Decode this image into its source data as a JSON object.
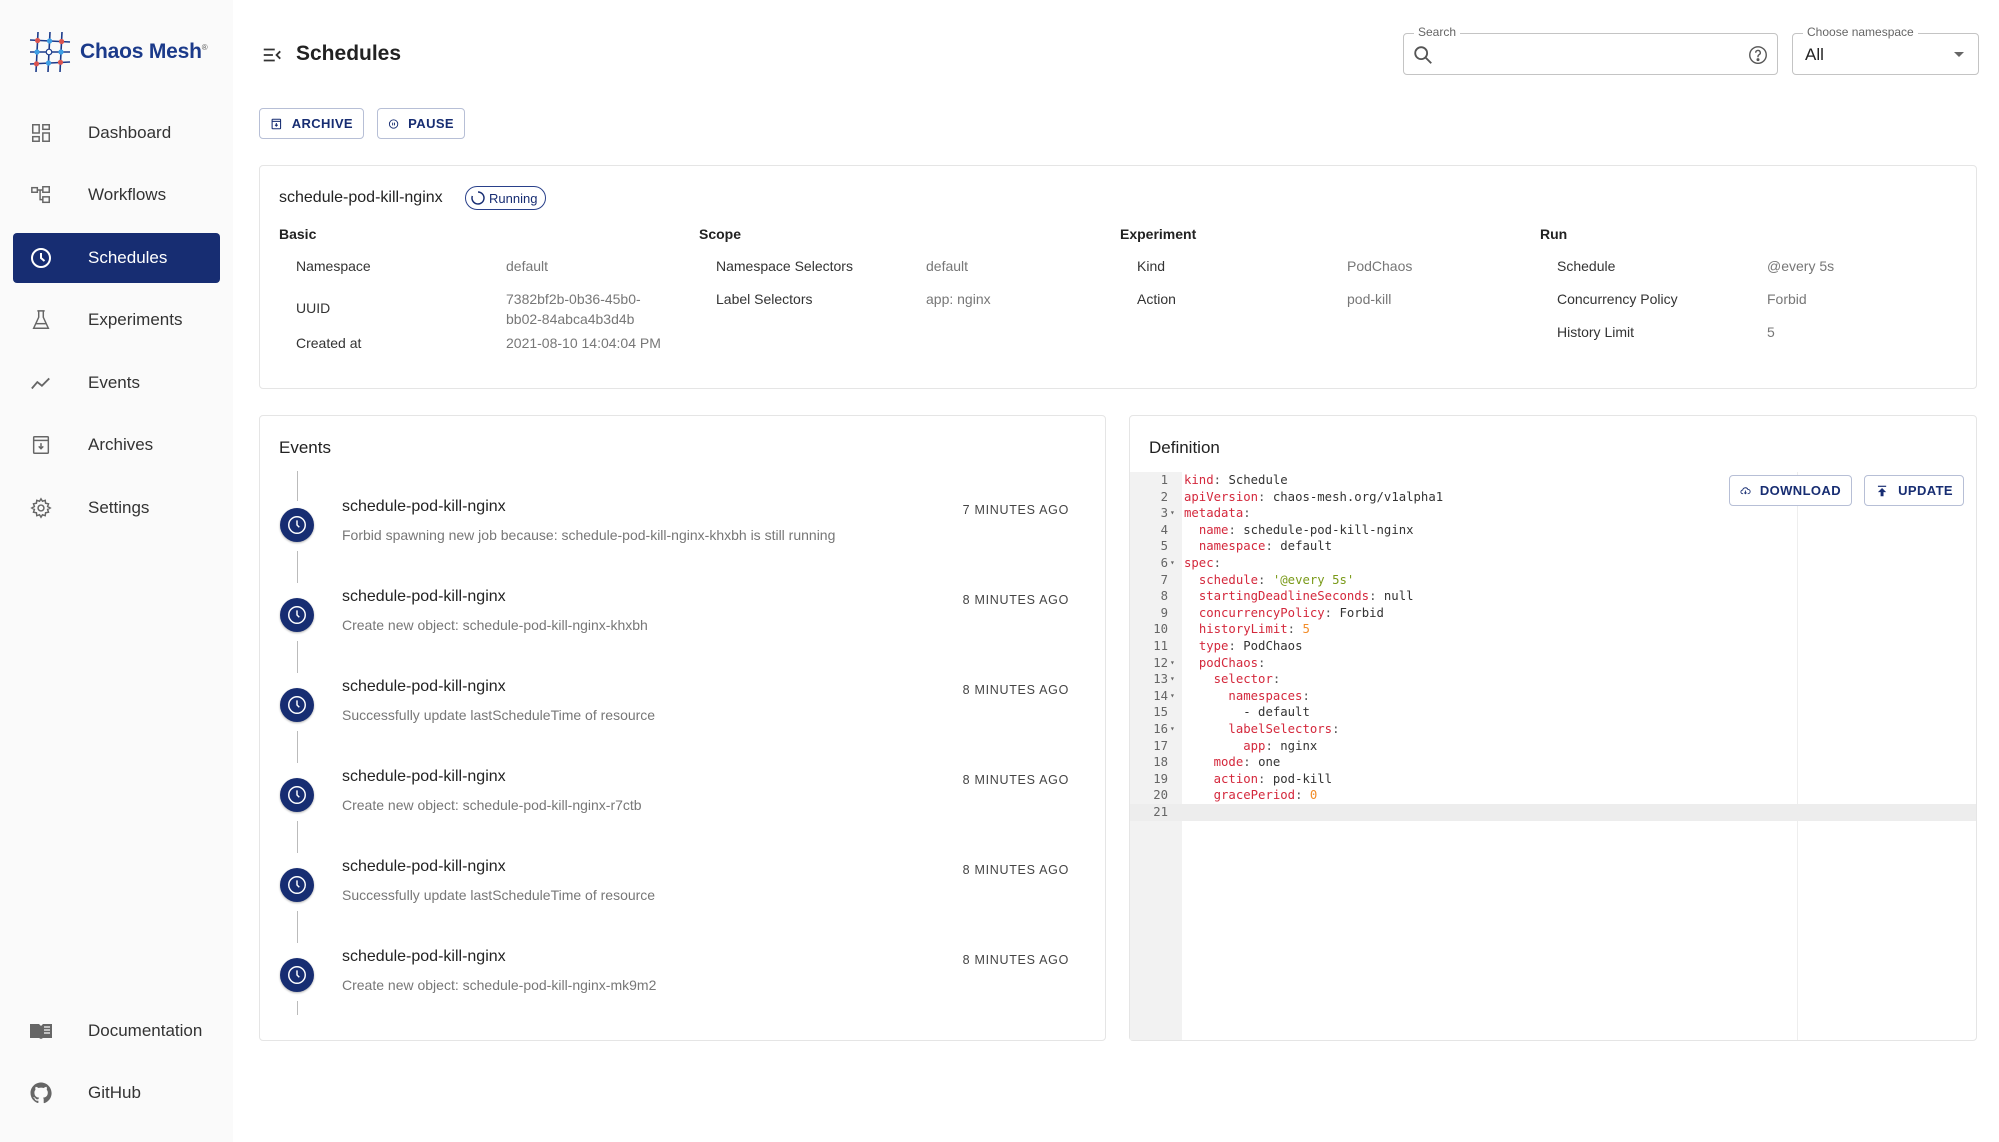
{
  "app": {
    "brand": "Chaos Mesh",
    "brand_mark": "®"
  },
  "sidebar": {
    "items": [
      {
        "label": "Dashboard",
        "icon": "dashboard-icon"
      },
      {
        "label": "Workflows",
        "icon": "workflow-icon"
      },
      {
        "label": "Schedules",
        "icon": "clock-icon",
        "active": true
      },
      {
        "label": "Experiments",
        "icon": "flask-icon"
      },
      {
        "label": "Events",
        "icon": "timeline-icon"
      },
      {
        "label": "Archives",
        "icon": "archive-icon"
      },
      {
        "label": "Settings",
        "icon": "gear-icon"
      }
    ],
    "footer_items": [
      {
        "label": "Documentation",
        "icon": "book-icon"
      },
      {
        "label": "GitHub",
        "icon": "github-icon"
      }
    ]
  },
  "header": {
    "title": "Schedules",
    "search": {
      "legend": "Search",
      "value": "",
      "placeholder": ""
    },
    "namespace": {
      "legend": "Choose namespace",
      "selected": "All"
    }
  },
  "actions": {
    "archive_label": "ARCHIVE",
    "pause_label": "PAUSE"
  },
  "schedule": {
    "name": "schedule-pod-kill-nginx",
    "status": "Running",
    "sections": {
      "basic": {
        "title": "Basic",
        "rows": [
          {
            "key": "Namespace",
            "value": "default"
          },
          {
            "key": "UUID",
            "value": "7382bf2b-0b36-45b0-bb02-84abca4b3d4b"
          },
          {
            "key": "Created at",
            "value": "2021-08-10 14:04:04 PM"
          }
        ]
      },
      "scope": {
        "title": "Scope",
        "rows": [
          {
            "key": "Namespace Selectors",
            "value": "default"
          },
          {
            "key": "Label Selectors",
            "value": "app: nginx"
          }
        ]
      },
      "experiment": {
        "title": "Experiment",
        "rows": [
          {
            "key": "Kind",
            "value": "PodChaos"
          },
          {
            "key": "Action",
            "value": "pod-kill"
          }
        ]
      },
      "run": {
        "title": "Run",
        "rows": [
          {
            "key": "Schedule",
            "value": "@every 5s"
          },
          {
            "key": "Concurrency Policy",
            "value": "Forbid"
          },
          {
            "key": "History Limit",
            "value": "5"
          }
        ]
      }
    }
  },
  "events": {
    "title": "Events",
    "items": [
      {
        "name": "schedule-pod-kill-nginx",
        "message": "Forbid spawning new job because: schedule-pod-kill-nginx-khxbh is still running",
        "time": "7 MINUTES AGO"
      },
      {
        "name": "schedule-pod-kill-nginx",
        "message": "Create new object: schedule-pod-kill-nginx-khxbh",
        "time": "8 MINUTES AGO"
      },
      {
        "name": "schedule-pod-kill-nginx",
        "message": "Successfully update lastScheduleTime of resource",
        "time": "8 MINUTES AGO"
      },
      {
        "name": "schedule-pod-kill-nginx",
        "message": "Create new object: schedule-pod-kill-nginx-r7ctb",
        "time": "8 MINUTES AGO"
      },
      {
        "name": "schedule-pod-kill-nginx",
        "message": "Successfully update lastScheduleTime of resource",
        "time": "8 MINUTES AGO"
      },
      {
        "name": "schedule-pod-kill-nginx",
        "message": "Create new object: schedule-pod-kill-nginx-mk9m2",
        "time": "8 MINUTES AGO"
      }
    ]
  },
  "definition": {
    "title": "Definition",
    "download_label": "DOWNLOAD",
    "update_label": "UPDATE",
    "current_line": 21,
    "lines": [
      {
        "n": 1,
        "indent": 0,
        "key": "kind",
        "value": "Schedule",
        "type": "plain"
      },
      {
        "n": 2,
        "indent": 0,
        "key": "apiVersion",
        "value": "chaos-mesh.org/v1alpha1",
        "type": "plain"
      },
      {
        "n": 3,
        "indent": 0,
        "key": "metadata",
        "value": "",
        "fold": true
      },
      {
        "n": 4,
        "indent": 1,
        "key": "name",
        "value": "schedule-pod-kill-nginx",
        "type": "plain"
      },
      {
        "n": 5,
        "indent": 1,
        "key": "namespace",
        "value": "default",
        "type": "plain"
      },
      {
        "n": 6,
        "indent": 0,
        "key": "spec",
        "value": "",
        "fold": true
      },
      {
        "n": 7,
        "indent": 1,
        "key": "schedule",
        "value": "'@every 5s'",
        "type": "string"
      },
      {
        "n": 8,
        "indent": 1,
        "key": "startingDeadlineSeconds",
        "value": "null",
        "type": "plain"
      },
      {
        "n": 9,
        "indent": 1,
        "key": "concurrencyPolicy",
        "value": "Forbid",
        "type": "plain"
      },
      {
        "n": 10,
        "indent": 1,
        "key": "historyLimit",
        "value": "5",
        "type": "number"
      },
      {
        "n": 11,
        "indent": 1,
        "key": "type",
        "value": "PodChaos",
        "type": "plain"
      },
      {
        "n": 12,
        "indent": 1,
        "key": "podChaos",
        "value": "",
        "fold": true
      },
      {
        "n": 13,
        "indent": 2,
        "key": "selector",
        "value": "",
        "fold": true
      },
      {
        "n": 14,
        "indent": 3,
        "key": "namespaces",
        "value": "",
        "fold": true
      },
      {
        "n": 15,
        "indent": 4,
        "key": "",
        "value": "- default",
        "type": "plain"
      },
      {
        "n": 16,
        "indent": 3,
        "key": "labelSelectors",
        "value": "",
        "fold": true
      },
      {
        "n": 17,
        "indent": 4,
        "key": "app",
        "value": "nginx",
        "type": "plain"
      },
      {
        "n": 18,
        "indent": 2,
        "key": "mode",
        "value": "one",
        "type": "plain"
      },
      {
        "n": 19,
        "indent": 2,
        "key": "action",
        "value": "pod-kill",
        "type": "plain"
      },
      {
        "n": 20,
        "indent": 2,
        "key": "gracePeriod",
        "value": "0",
        "type": "number"
      },
      {
        "n": 21,
        "indent": 0,
        "key": "",
        "value": "",
        "type": "plain"
      }
    ]
  },
  "colors": {
    "primary": "#172d72",
    "sidebar_bg": "#fafafa",
    "yaml_key": "#d4283c",
    "yaml_string": "#7a9a19",
    "yaml_number": "#f28c28"
  }
}
